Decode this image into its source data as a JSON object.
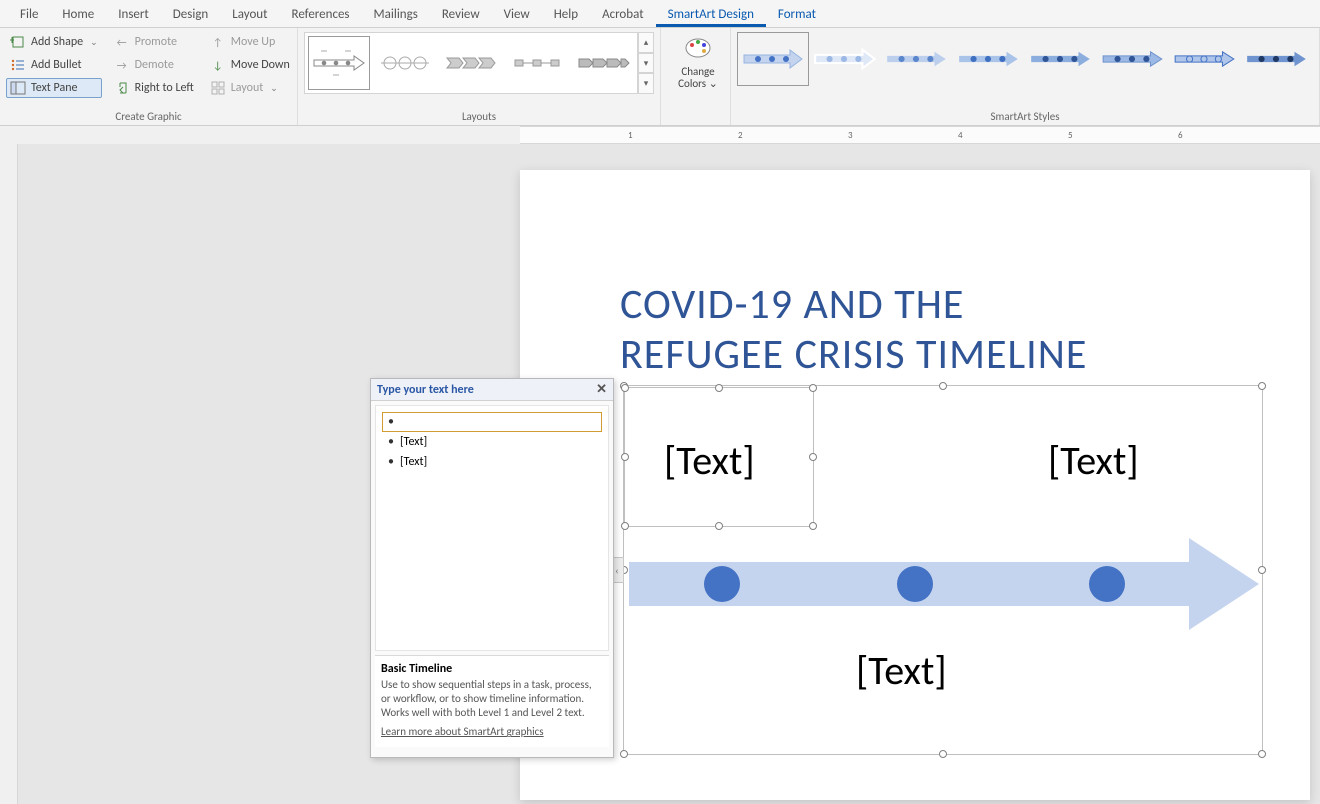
{
  "tabs": [
    "File",
    "Home",
    "Insert",
    "Design",
    "Layout",
    "References",
    "Mailings",
    "Review",
    "View",
    "Help",
    "Acrobat",
    "SmartArt Design",
    "Format"
  ],
  "active_tab_index": 11,
  "context_tab_indices": [
    11,
    12
  ],
  "ribbon": {
    "groups": {
      "create_graphic": {
        "title": "Create Graphic",
        "add_shape": "Add Shape",
        "add_bullet": "Add Bullet",
        "text_pane": "Text Pane",
        "promote": "Promote",
        "demote": "Demote",
        "right_to_left": "Right to Left",
        "move_up": "Move Up",
        "move_down": "Move Down",
        "layout": "Layout"
      },
      "layouts": {
        "title": "Layouts"
      },
      "change_colors": {
        "label": "Change Colors"
      },
      "styles": {
        "title": "SmartArt Styles"
      }
    }
  },
  "document": {
    "title_line1": "COVID-19 AND THE",
    "title_line2": "REFUGEE CRISIS TIMELINE",
    "smartart": {
      "labels": [
        "[Text]",
        "[Text]",
        "[Text]"
      ]
    }
  },
  "text_pane": {
    "header": "Type your text here",
    "items": [
      "",
      "[Text]",
      "[Text]"
    ],
    "info": {
      "name": "Basic Timeline",
      "desc": "Use to show sequential steps in a task, process, or workflow, or to show timeline information. Works well with both Level 1 and Level 2 text.",
      "link": "Learn more about SmartArt graphics"
    }
  },
  "ruler": {
    "units": [
      1,
      2,
      3,
      4,
      5,
      6
    ]
  }
}
